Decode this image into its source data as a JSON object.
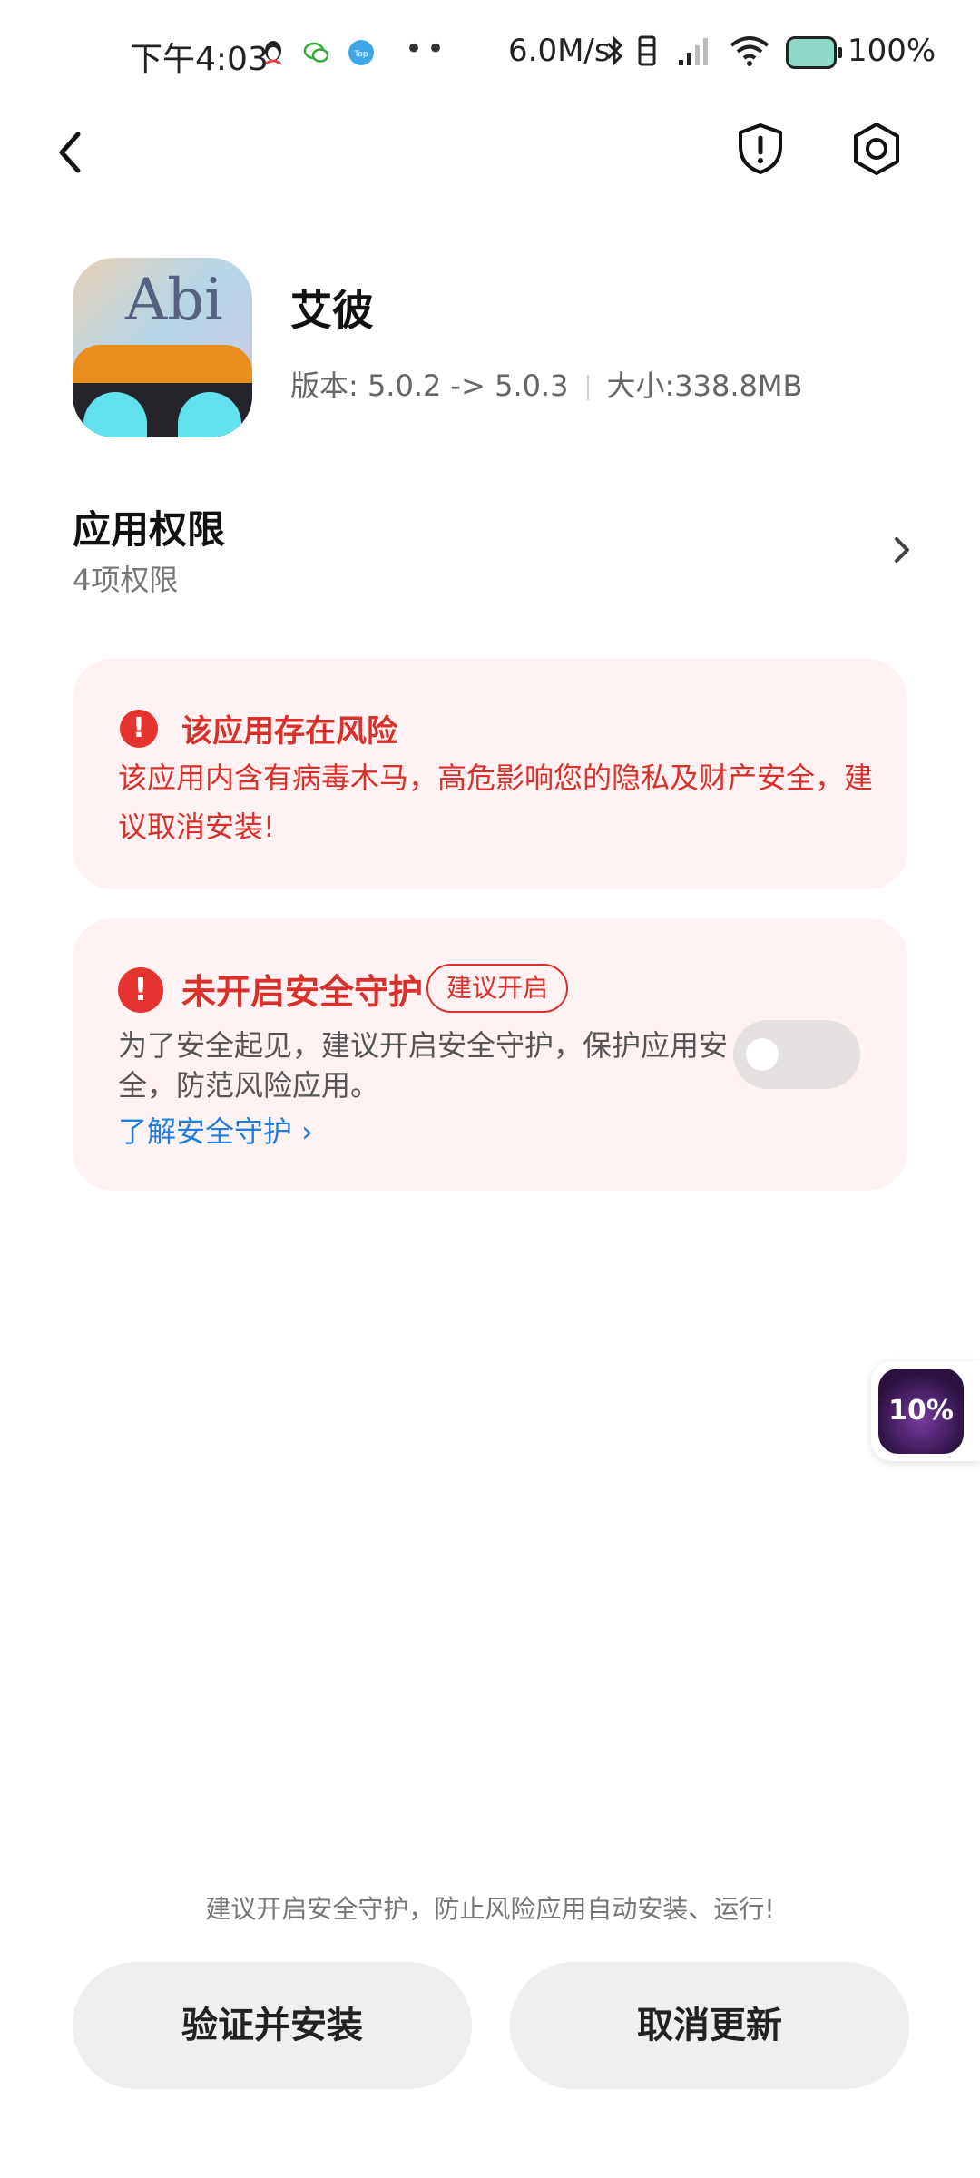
{
  "status_bar": {
    "time": "下午4:03",
    "more_dots": "••",
    "net_speed": "6.0M/s",
    "battery": "100%",
    "notification_icons": [
      "qq-icon",
      "wechat-icon",
      "top-icon"
    ],
    "status_icons": [
      "bluetooth-icon",
      "vibrate-icon",
      "signal-icon",
      "wifi-icon",
      "battery-icon"
    ]
  },
  "header": {
    "back_icon": "chevron-left-icon",
    "shield_icon": "shield-alert-icon",
    "settings_icon": "settings-hexagon-icon"
  },
  "app": {
    "icon_text": "Abi",
    "name": "艾彼",
    "version": "版本: 5.0.2 -> 5.0.3",
    "size": "大小:338.8MB"
  },
  "permissions": {
    "title": "应用权限",
    "count": "4项权限"
  },
  "risk_card": {
    "title": "该应用存在风险",
    "message": "该应用内含有病毒木马，高危影响您的隐私及财产安全，建议取消安装!"
  },
  "guard_card": {
    "title": "未开启安全守护",
    "badge": "建议开启",
    "message": "为了安全起见，建议开启安全守护，保护应用安全，防范风险应用。",
    "link": "了解安全守护 ›",
    "toggle_on": false
  },
  "floating_widget": {
    "label": "10%"
  },
  "footer": {
    "tip": "建议开启安全守护，防止风险应用自动安装、运行!",
    "install_button": "验证并安装",
    "cancel_button": "取消更新"
  },
  "colors": {
    "danger": "#d9302b",
    "card_bg": "#fff2f2",
    "link": "#1f7fe0",
    "button_bg": "#efefef"
  }
}
